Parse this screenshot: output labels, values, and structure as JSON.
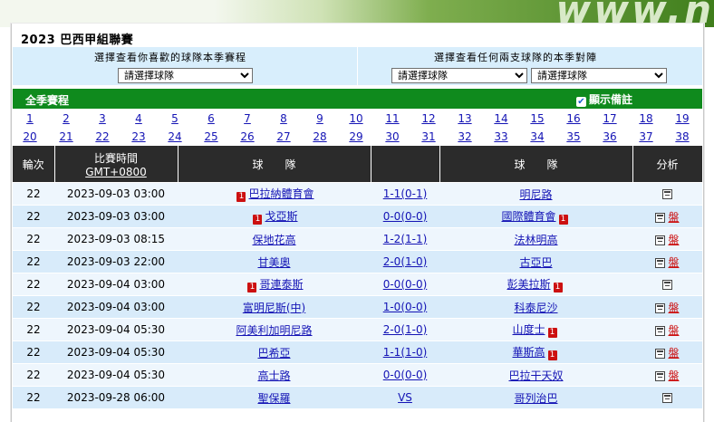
{
  "title": "2023 巴西甲組聯賽",
  "picker": {
    "left_label": "選擇查看你喜歡的球隊本季賽程",
    "right_label": "選擇查看任何兩支球隊的本季對陣",
    "select_placeholder": "請選擇球隊"
  },
  "season": {
    "label": "全季賽程",
    "checkbox_label": "顯示備註"
  },
  "rounds": [
    "1",
    "2",
    "3",
    "4",
    "5",
    "6",
    "7",
    "8",
    "9",
    "10",
    "11",
    "12",
    "13",
    "14",
    "15",
    "16",
    "17",
    "18",
    "19",
    "20",
    "21",
    "22",
    "23",
    "24",
    "25",
    "26",
    "27",
    "28",
    "29",
    "30",
    "31",
    "32",
    "33",
    "34",
    "35",
    "36",
    "37",
    "38"
  ],
  "table": {
    "headers": {
      "round": "輪次",
      "time_line1": "比賽時間",
      "time_line2": "GMT+0800",
      "home": "球　　隊",
      "away": "球　　隊",
      "analysis": "分析"
    },
    "odds_text": "盤",
    "red_card_text": "1",
    "rows": [
      {
        "round": "22",
        "time": "2023-09-03 03:00",
        "home": "巴拉納體育會",
        "home_red": true,
        "score": "1-1(0-1)",
        "away": "明尼路",
        "away_red": false,
        "odds": false
      },
      {
        "round": "22",
        "time": "2023-09-03 03:00",
        "home": "戈亞斯",
        "home_red": true,
        "score": "0-0(0-0)",
        "away": "國際體育會",
        "away_red": true,
        "odds": true
      },
      {
        "round": "22",
        "time": "2023-09-03 08:15",
        "home": "保地花高",
        "home_red": false,
        "score": "1-2(1-1)",
        "away": "法林明高",
        "away_red": false,
        "odds": true
      },
      {
        "round": "22",
        "time": "2023-09-03 22:00",
        "home": "甘美奧",
        "home_red": false,
        "score": "2-0(1-0)",
        "away": "古亞巴",
        "away_red": false,
        "odds": true
      },
      {
        "round": "22",
        "time": "2023-09-04 03:00",
        "home": "哥連泰斯",
        "home_red": true,
        "score": "0-0(0-0)",
        "away": "彭美拉斯",
        "away_red": true,
        "odds": false
      },
      {
        "round": "22",
        "time": "2023-09-04 03:00",
        "home": "富明尼斯(中)",
        "home_red": false,
        "score": "1-0(0-0)",
        "away": "科泰尼沙",
        "away_red": false,
        "odds": true
      },
      {
        "round": "22",
        "time": "2023-09-04 05:30",
        "home": "阿美利加明尼路",
        "home_red": false,
        "score": "2-0(1-0)",
        "away": "山度士",
        "away_red": true,
        "odds": true
      },
      {
        "round": "22",
        "time": "2023-09-04 05:30",
        "home": "巴希亞",
        "home_red": false,
        "score": "1-1(1-0)",
        "away": "華斯高",
        "away_red": true,
        "odds": true
      },
      {
        "round": "22",
        "time": "2023-09-04 05:30",
        "home": "高士路",
        "home_red": false,
        "score": "0-0(0-0)",
        "away": "巴拉干天奴",
        "away_red": false,
        "odds": true
      },
      {
        "round": "22",
        "time": "2023-09-28 06:00",
        "home": "聖保羅",
        "home_red": false,
        "score": "VS",
        "away": "哥列治巴",
        "away_red": false,
        "odds": false
      }
    ]
  }
}
